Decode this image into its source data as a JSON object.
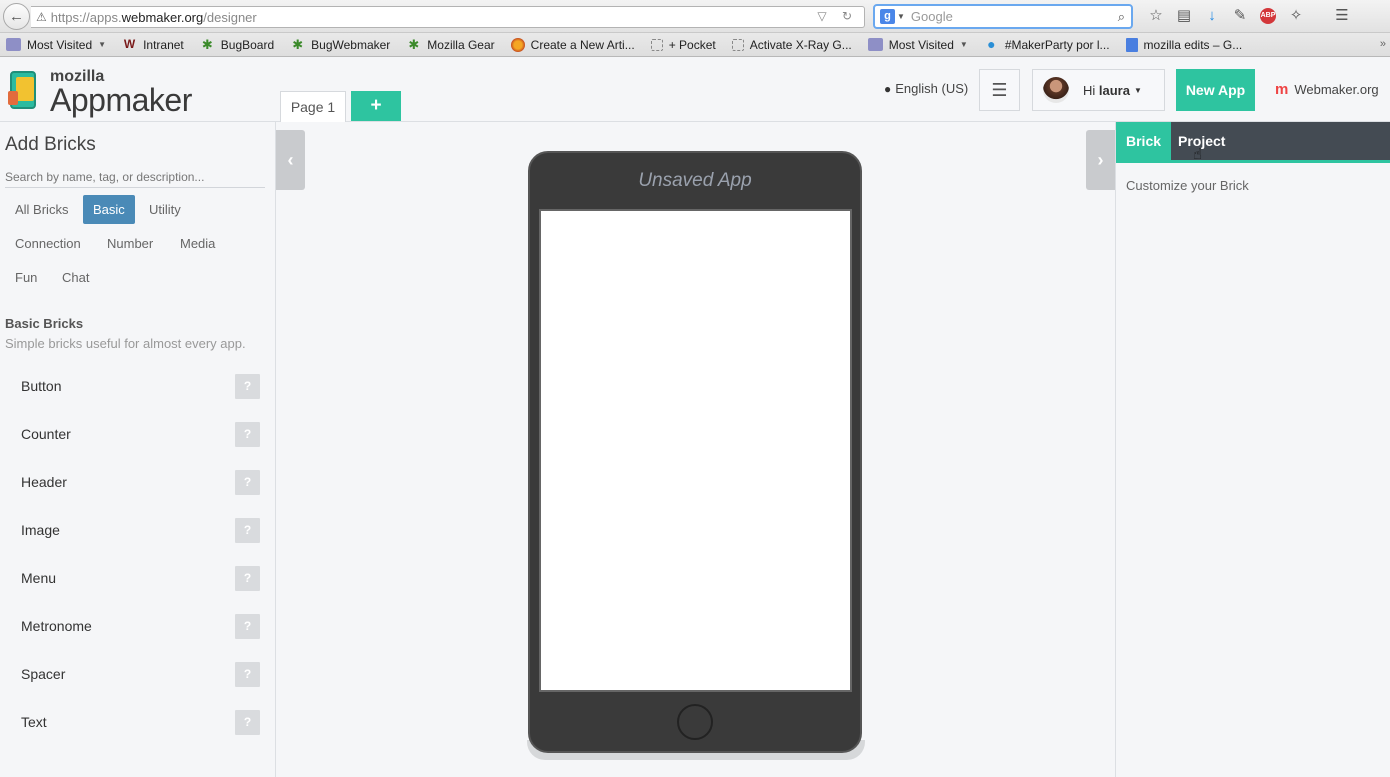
{
  "browser": {
    "url_prefix": "https://apps.",
    "url_domain": "webmaker.org",
    "url_path": "/designer",
    "url_controls": "▽ ↻",
    "search_placeholder": "Google",
    "bookmarks": [
      {
        "label": "Most Visited",
        "icon": "folder-icon",
        "has_dropdown": true
      },
      {
        "label": "Intranet",
        "icon": "wordpress-icon"
      },
      {
        "label": "BugBoard",
        "icon": "bug-icon"
      },
      {
        "label": "BugWebmaker",
        "icon": "bug-icon"
      },
      {
        "label": "Mozilla Gear",
        "icon": "bug-icon"
      },
      {
        "label": "Create a New Arti...",
        "icon": "firefox-icon"
      },
      {
        "label": "+ Pocket",
        "icon": "blank-page-icon"
      },
      {
        "label": "Activate X-Ray G...",
        "icon": "blank-page-icon"
      },
      {
        "label": "Most Visited",
        "icon": "folder-icon",
        "has_dropdown": true
      },
      {
        "label": "#MakerParty por l...",
        "icon": "globe-icon"
      },
      {
        "label": "mozilla edits – G...",
        "icon": "doc-icon"
      }
    ]
  },
  "app": {
    "logo_top": "mozilla",
    "logo_main": "Appmaker",
    "page_tab": "Page 1",
    "add_page": "+",
    "language": "English (US)",
    "greeting_prefix": "Hi ",
    "username": "laura",
    "new_app_label": "New App",
    "webmaker_label": "Webmaker.org",
    "accent_color": "#2ec4a0",
    "active_filter_color": "#4a8ab7"
  },
  "left_panel": {
    "title": "Add Bricks",
    "search_placeholder": "Search by name, tag, or description...",
    "filters": [
      {
        "label": "All Bricks",
        "active": false
      },
      {
        "label": "Basic",
        "active": true
      },
      {
        "label": "Utility",
        "active": false
      },
      {
        "label": "Connection",
        "active": false
      },
      {
        "label": "Number",
        "active": false
      },
      {
        "label": "Media",
        "active": false
      },
      {
        "label": "Fun",
        "active": false
      },
      {
        "label": "Chat",
        "active": false
      }
    ],
    "group_title": "Basic Bricks",
    "group_desc": "Simple bricks useful for almost every app.",
    "help_label": "?",
    "bricks": [
      "Button",
      "Counter",
      "Header",
      "Image",
      "Menu",
      "Metronome",
      "Spacer",
      "Text"
    ]
  },
  "canvas": {
    "app_title": "Unsaved App",
    "collapse_left": "‹",
    "collapse_right": "›"
  },
  "right_panel": {
    "tabs": [
      {
        "label": "Brick",
        "active": true
      },
      {
        "label": "Project",
        "active": false
      }
    ],
    "description": "Customize your Brick"
  }
}
